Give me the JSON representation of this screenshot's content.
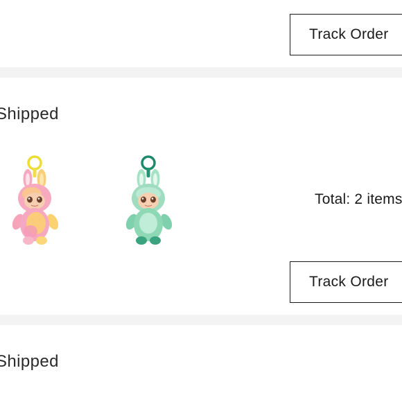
{
  "orders": [
    {
      "track_label": "Track Order"
    },
    {
      "status": "Shipped",
      "items": [
        {
          "name": "pink-yellow-plush-keychain",
          "colors": {
            "body": "#f7b6c8",
            "belly": "#fbe07a",
            "ring": "#f0e04a",
            "face": "#f4c9a8"
          }
        },
        {
          "name": "mint-green-plush-keychain",
          "colors": {
            "body": "#9fe0c2",
            "belly": "#c9f2dc",
            "ring": "#1f8c6e",
            "face": "#f4c9a8"
          }
        }
      ],
      "total_label": "Total: 2 items",
      "track_label": "Track Order"
    },
    {
      "status": "Shipped"
    }
  ]
}
